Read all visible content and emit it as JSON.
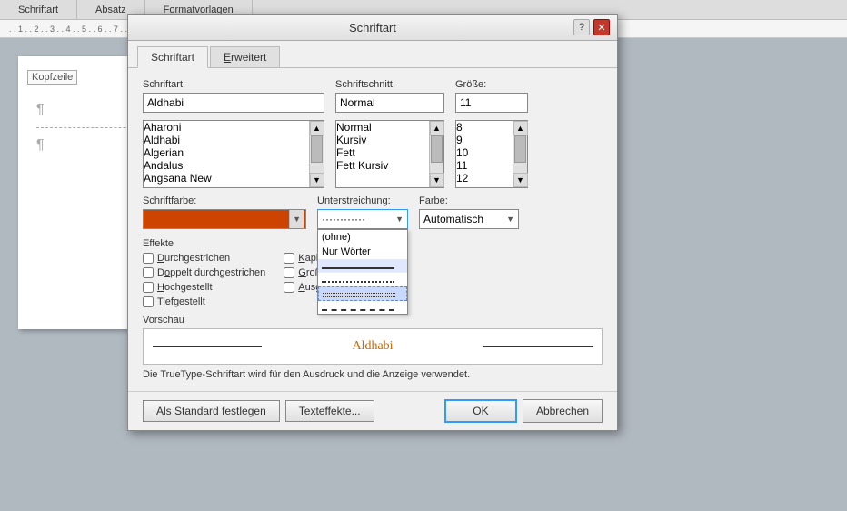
{
  "app": {
    "toolbar_sections": [
      "Schriftart",
      "Absatz",
      "Formatvorlagen"
    ]
  },
  "dialog": {
    "title": "Schriftart",
    "tabs": [
      {
        "label": "Schriftart",
        "underline_char": "S",
        "active": true
      },
      {
        "label": "Erweitert",
        "underline_char": "E",
        "active": false
      }
    ],
    "schriftart_label": "Schriftart:",
    "schriftart_value": "Aldhabi",
    "schriftschnitt_label": "Schriftschnitt:",
    "schriftschnitt_value": "Normal",
    "groesse_label": "Größe:",
    "groesse_value": "11",
    "font_list": [
      {
        "name": "Aharoni",
        "selected": false
      },
      {
        "name": "Aldhabi",
        "selected": true
      },
      {
        "name": "Algerian",
        "selected": false
      },
      {
        "name": "Andalus",
        "selected": false
      },
      {
        "name": "Angsana New",
        "selected": false
      }
    ],
    "schnitt_list": [
      {
        "name": "Normal",
        "selected": true
      },
      {
        "name": "Kursiv",
        "selected": false
      },
      {
        "name": "Fett",
        "selected": false
      },
      {
        "name": "Fett Kursiv",
        "selected": false
      }
    ],
    "groesse_list": [
      {
        "val": "8"
      },
      {
        "val": "9"
      },
      {
        "val": "10"
      },
      {
        "val": "11",
        "selected": true
      },
      {
        "val": "12"
      }
    ],
    "schriftfarbe_label": "Schriftfarbe:",
    "unterstreichung_label": "Unterstreichung:",
    "farbe_label": "Farbe:",
    "farbe_value": "Automatisch",
    "effekte_label": "Effekte",
    "checkboxes_left": [
      {
        "id": "durchgestrichen",
        "label": "Durchgestrichen",
        "ul": "D",
        "checked": false
      },
      {
        "id": "doppelt",
        "label": "Doppelt durchgestrichen",
        "ul": "o",
        "checked": false
      },
      {
        "id": "hochgestellt",
        "label": "Hochgestellt",
        "ul": "H",
        "checked": false
      },
      {
        "id": "tiefgestellt",
        "label": "Tiefgestellt",
        "ul": "i",
        "checked": false
      }
    ],
    "checkboxes_right": [
      {
        "id": "kapitalchen",
        "label": "Kapitälchen",
        "ul": "K",
        "checked": false
      },
      {
        "id": "grossbuchstaben",
        "label": "Großbuchstaben",
        "ul": "G",
        "checked": false
      },
      {
        "id": "ausgeblendet",
        "label": "Ausgeblendet",
        "ul": "A",
        "checked": false
      }
    ],
    "vorschau_label": "Vorschau",
    "vorschau_text": "Aldhabi",
    "info_text": "Die TrueType-Schriftart wird für den Ausdruck und die Anzeige verwendet.",
    "unterstr_options": [
      {
        "label": "(ohne)"
      },
      {
        "label": "Nur Wörter"
      },
      {
        "label": "—— (Linie)"
      },
      {
        "label": "···· (Punkte)"
      },
      {
        "label": "---- (Striche)"
      }
    ],
    "buttons": {
      "standard": "Als Standard festlegen",
      "standard_ul": "A",
      "texteffekte": "Texteffekte...",
      "texteffekte_ul": "e",
      "ok": "OK",
      "abbrechen": "Abbrechen"
    }
  }
}
